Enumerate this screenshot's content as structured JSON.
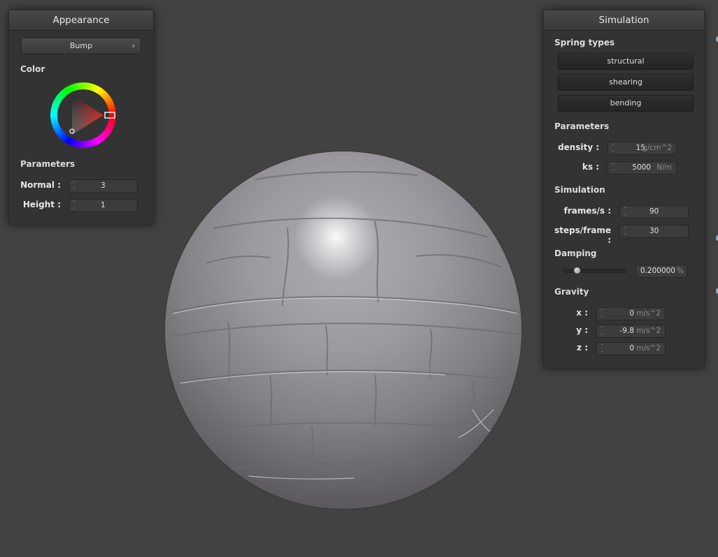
{
  "appearance": {
    "title": "Appearance",
    "shader_button": "Bump",
    "shader_chevron": "›",
    "color_label": "Color",
    "color_wheel_icon": "color-wheel",
    "parameters_label": "Parameters",
    "normal": {
      "label": "Normal :",
      "value": "3"
    },
    "height": {
      "label": "Height :",
      "value": "1"
    }
  },
  "simulation": {
    "title": "Simulation",
    "spring_types_label": "Spring types",
    "spring_buttons": [
      "structural",
      "shearing",
      "bending"
    ],
    "parameters_label": "Parameters",
    "density": {
      "label": "density :",
      "value": "15",
      "unit": "g/cm^2"
    },
    "ks": {
      "label": "ks :",
      "value": "5000",
      "unit": "N/m"
    },
    "simulation_label": "Simulation",
    "frames_per_s": {
      "label": "frames/s :",
      "value": "90"
    },
    "steps_per_frame": {
      "label": "steps/frame :",
      "value": "30"
    },
    "damping_label": "Damping",
    "damping": {
      "value": "0.200000",
      "unit": "%",
      "slider_level": 0.2
    },
    "gravity_label": "Gravity",
    "gravity_x": {
      "label": "x :",
      "value": "0",
      "unit": "m/s^2"
    },
    "gravity_y": {
      "label": "y :",
      "value": "-9.8",
      "unit": "m/s^2"
    },
    "gravity_z": {
      "label": "z :",
      "value": "0",
      "unit": "m/s^2"
    }
  },
  "colors": {
    "background": "#424242",
    "panel": "#333333",
    "sphere": "#9d99a0"
  }
}
